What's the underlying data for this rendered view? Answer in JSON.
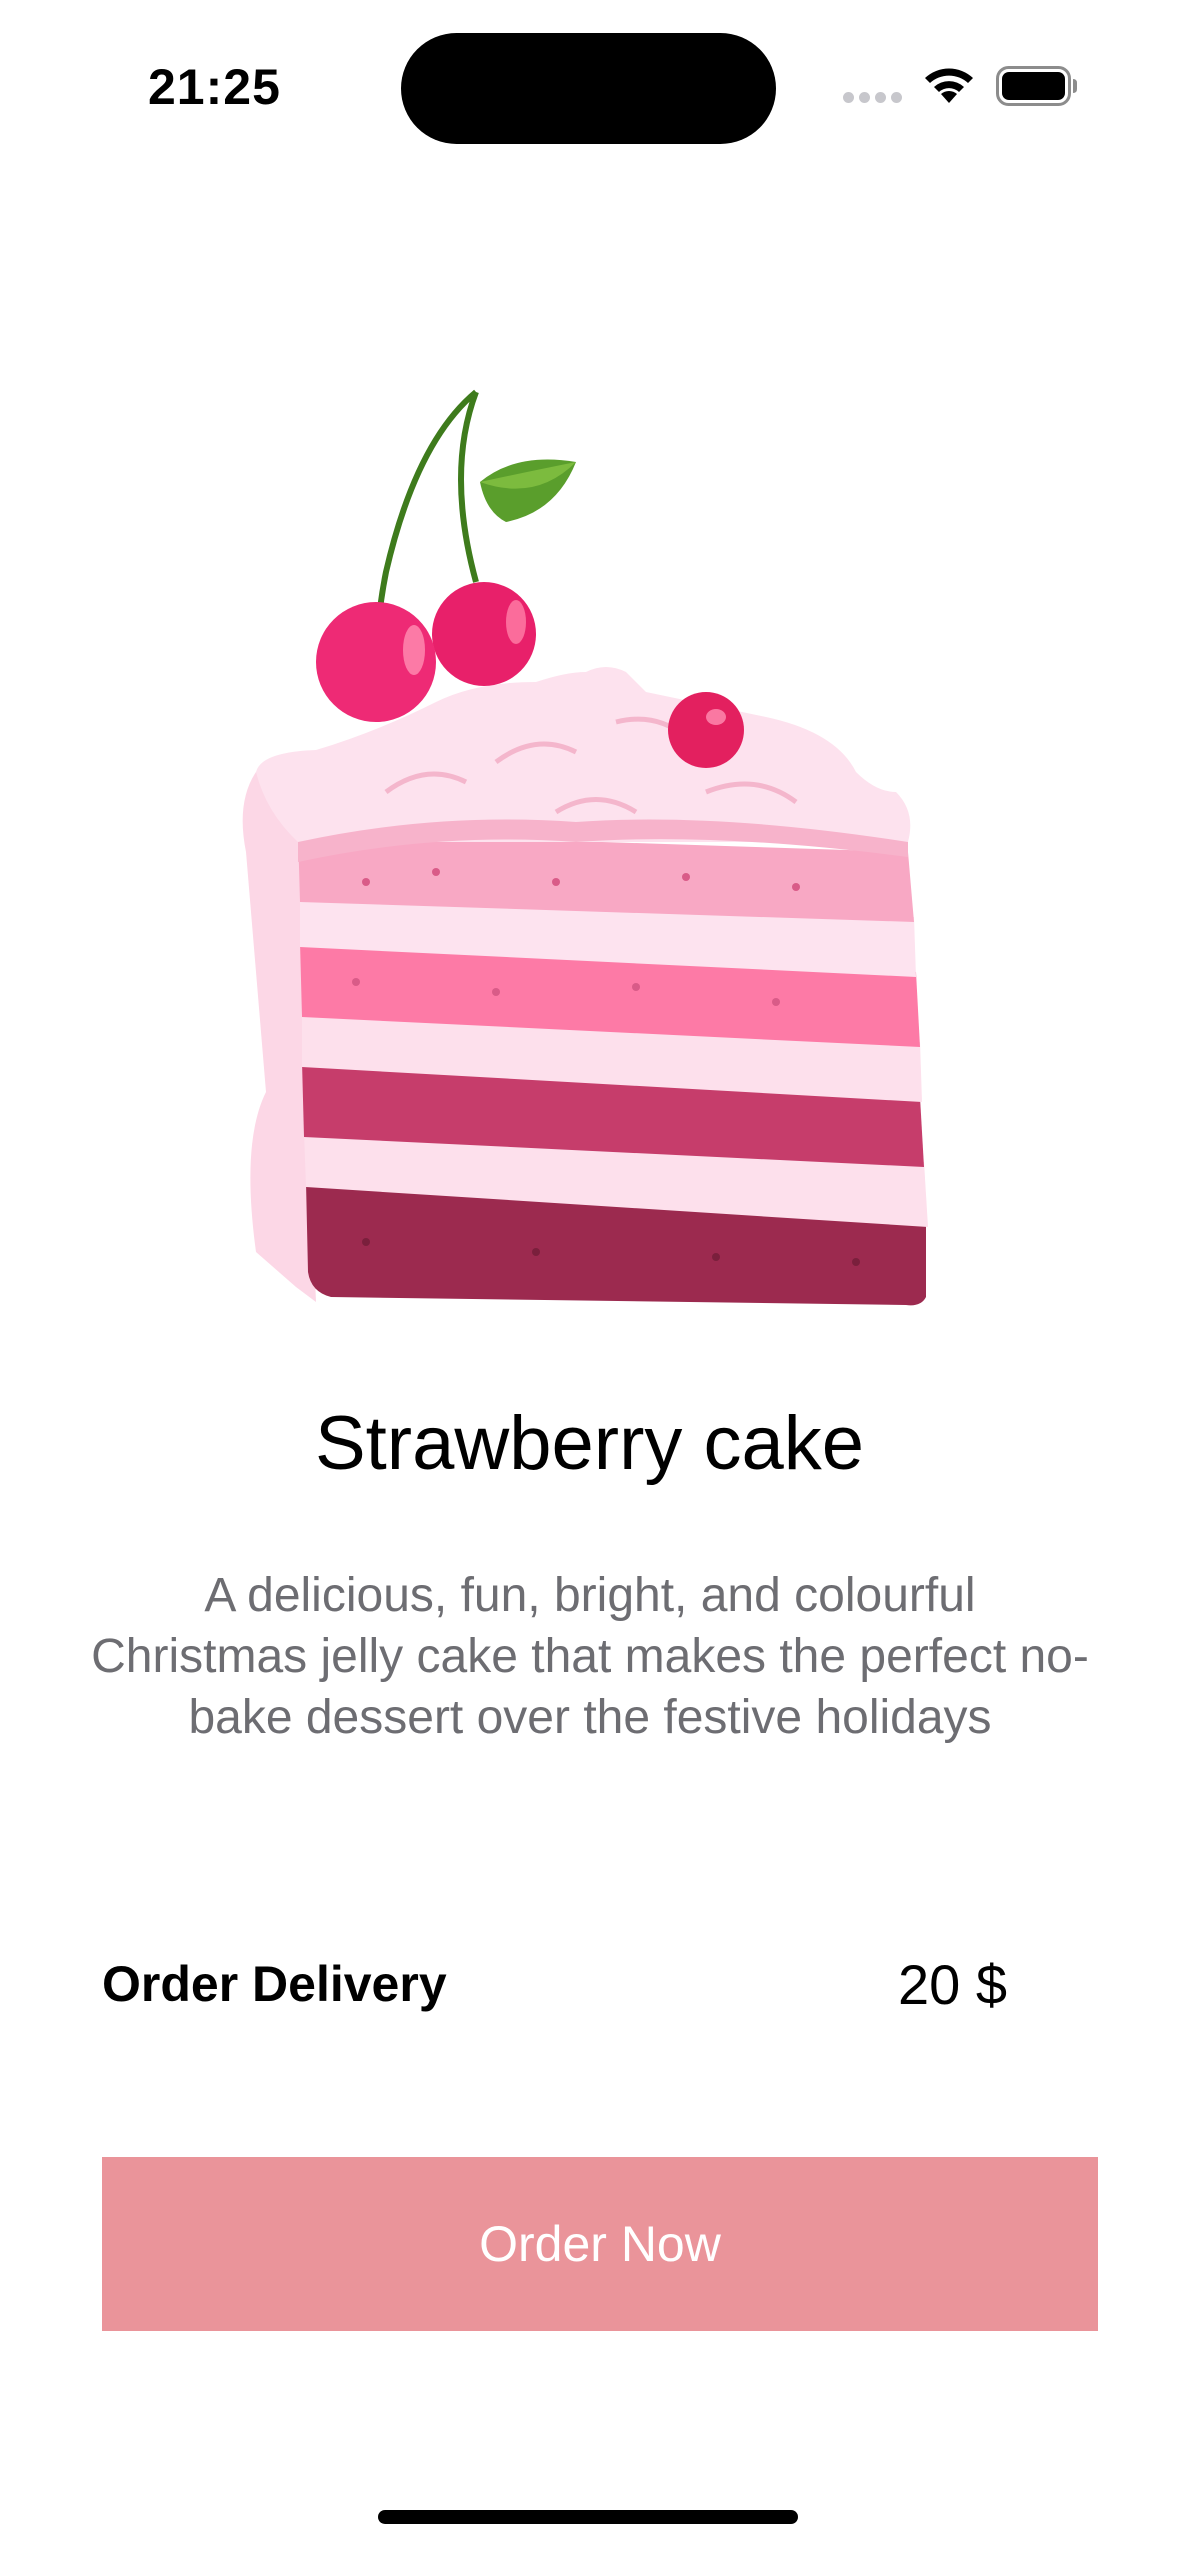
{
  "status_bar": {
    "time": "21:25"
  },
  "product": {
    "image_icon": "strawberry-cake-slice-illustration",
    "title": "Strawberry cake",
    "description": "A delicious, fun, bright, and colourful Christmas jelly cake that makes the perfect no-bake dessert over the festive holidays"
  },
  "delivery": {
    "label": "Order Delivery",
    "price": "20 $"
  },
  "order_button": {
    "label": "Order Now"
  },
  "colors": {
    "button_bg": "#ea949a",
    "button_text": "#ffffff",
    "description_text": "#6d6d72"
  }
}
